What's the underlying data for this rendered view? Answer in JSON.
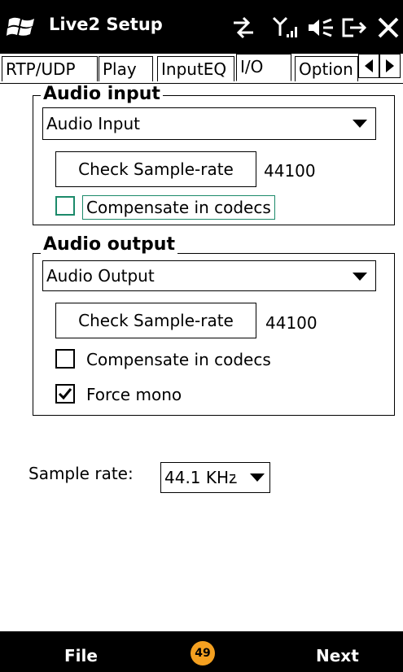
{
  "title_bar": {
    "title": "Live2 Setup",
    "icons": [
      "windows-flag-icon",
      "data-connection-icon",
      "signal-strength-icon",
      "volume-icon",
      "battery-icon",
      "close-icon"
    ]
  },
  "tabs": [
    {
      "label": "RTP/UDP"
    },
    {
      "label": "Play"
    },
    {
      "label": "InputEQ"
    },
    {
      "label": "I/O"
    },
    {
      "label": "Option"
    }
  ],
  "audio_input": {
    "legend": "Audio input",
    "device_selected": "Audio Input",
    "check_button": "Check Sample-rate",
    "sample_rate_value": "44100",
    "compensate_label": "Compensate in codecs",
    "compensate_checked": false
  },
  "audio_output": {
    "legend": "Audio output",
    "device_selected": "Audio Output",
    "check_button": "Check Sample-rate",
    "sample_rate_value": "44100",
    "compensate_label": "Compensate in codecs",
    "compensate_checked": false,
    "force_mono_label": "Force mono",
    "force_mono_checked": true
  },
  "sample_rate": {
    "label": "Sample rate:",
    "selected": "44.1 KHz"
  },
  "softkeys": {
    "left": "File",
    "right": "Next",
    "center_badge": "49"
  },
  "colors": {
    "bar_background": "#000000",
    "focus_accent": "#1c8a6a",
    "badge": "#f4a020"
  }
}
